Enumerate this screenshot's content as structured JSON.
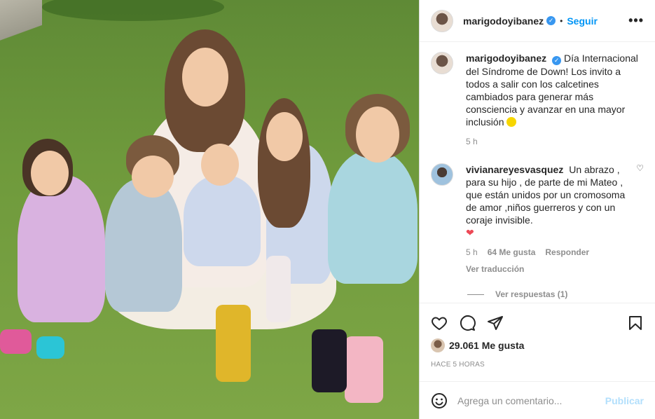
{
  "post": {
    "author": "marigodoyibanez",
    "follow_label": "Seguir",
    "dot": "•",
    "more_label": "•••"
  },
  "caption": {
    "username": "marigodoyibanez",
    "text": "Día Internacional del Síndrome de Down! Los invito a todos a salir con los calcetines cambiados para generar más consciencia y avanzar en una mayor inclusión",
    "time": "5 h"
  },
  "comments": [
    {
      "username": "vivianareyesvasquez",
      "text": "Un abrazo , para su hijo , de parte de mi Mateo , que están unidos por un cromosoma de amor ,niños guerreros y con un coraje invisible.",
      "time": "5 h",
      "likes": "64 Me gusta",
      "reply_label": "Responder",
      "translate_label": "Ver traducción",
      "view_replies": "Ver respuestas (1)"
    }
  ],
  "engagement": {
    "likes": "29.061 Me gusta",
    "posted": "HACE 5 HORAS"
  },
  "composer": {
    "placeholder": "Agrega un comentario...",
    "publish_label": "Publicar"
  },
  "colors": {
    "link_blue": "#0095f6",
    "publish_disabled": "#b2dffc",
    "verified_blue": "#3897f0",
    "like_red": "#ed4956"
  },
  "icons": [
    "verified-badge-icon",
    "more-options-icon",
    "heart-icon",
    "comment-icon",
    "share-icon",
    "bookmark-icon",
    "emoji-icon",
    "yellow-heart-emoji",
    "red-heart-emoji"
  ]
}
